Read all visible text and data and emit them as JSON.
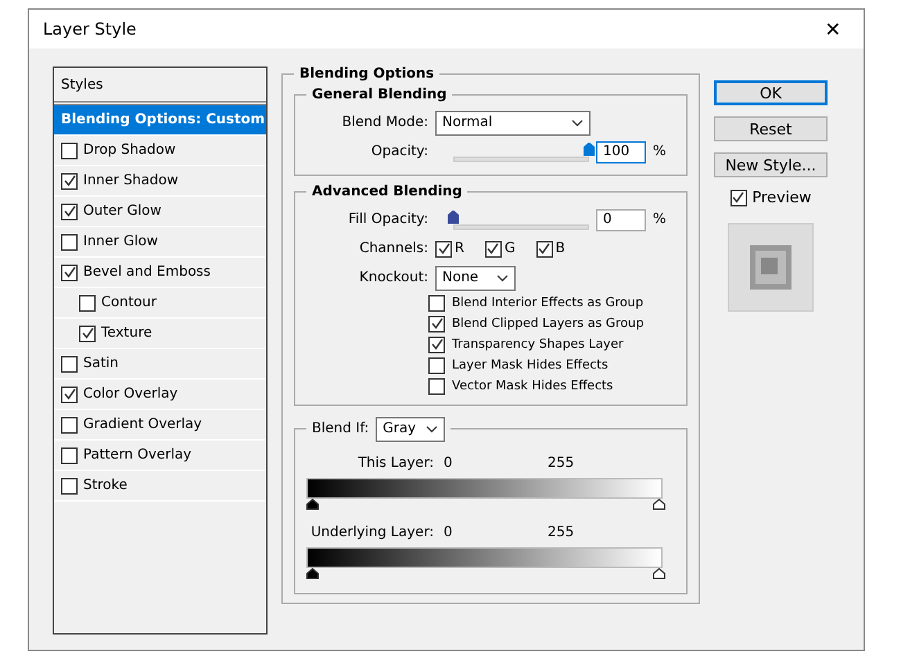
{
  "window": {
    "title": "Layer Style",
    "close": "✕"
  },
  "styles_header": "Styles",
  "styles": [
    {
      "label": "Blending Options: Custom",
      "kind": "header",
      "selected": true
    },
    {
      "label": "Drop Shadow",
      "kind": "check",
      "checked": false,
      "selected": false
    },
    {
      "label": "Inner Shadow",
      "kind": "check",
      "checked": true,
      "selected": false
    },
    {
      "label": "Outer Glow",
      "kind": "check",
      "checked": true,
      "selected": false
    },
    {
      "label": "Inner Glow",
      "kind": "check",
      "checked": false,
      "selected": false
    },
    {
      "label": "Bevel and Emboss",
      "kind": "check",
      "checked": true,
      "selected": false,
      "children": [
        {
          "label": "Contour",
          "kind": "check",
          "checked": false,
          "selected": false
        },
        {
          "label": "Texture",
          "kind": "check",
          "checked": true,
          "selected": false
        }
      ]
    },
    {
      "label": "Satin",
      "kind": "check",
      "checked": false,
      "selected": false
    },
    {
      "label": "Color Overlay",
      "kind": "check",
      "checked": true,
      "selected": false
    },
    {
      "label": "Gradient Overlay",
      "kind": "check",
      "checked": false,
      "selected": false
    },
    {
      "label": "Pattern Overlay",
      "kind": "check",
      "checked": false,
      "selected": false
    },
    {
      "label": "Stroke",
      "kind": "check",
      "checked": false,
      "selected": false
    }
  ],
  "blending_options": {
    "title": "Blending Options",
    "general": {
      "title": "General Blending",
      "blend_mode_label": "Blend Mode:",
      "blend_mode": "Normal",
      "opacity_label": "Opacity:",
      "opacity": {
        "level": 1,
        "value": "100",
        "unit": "%"
      }
    },
    "advanced": {
      "title": "Advanced Blending",
      "fill_opacity_label": "Fill Opacity:",
      "fill_opacity": {
        "level": 0,
        "value": "0",
        "unit": "%"
      },
      "channels_label": "Channels:",
      "channels": [
        {
          "label": "R",
          "checked": true
        },
        {
          "label": "G",
          "checked": true
        },
        {
          "label": "B",
          "checked": true
        }
      ],
      "knockout_label": "Knockout:",
      "knockout": "None",
      "options": [
        {
          "label": "Blend Interior Effects as Group",
          "checked": false
        },
        {
          "label": "Blend Clipped Layers as Group",
          "checked": true
        },
        {
          "label": "Transparency Shapes Layer",
          "checked": true
        },
        {
          "label": "Layer Mask Hides Effects",
          "checked": false
        },
        {
          "label": "Vector Mask Hides Effects",
          "checked": false
        }
      ]
    },
    "blend_if": {
      "label": "Blend If:",
      "value": "Gray",
      "ramps": [
        {
          "label": "This Layer:",
          "low": "0",
          "high": "255"
        },
        {
          "label": "Underlying Layer:",
          "low": "0",
          "high": "255"
        }
      ]
    }
  },
  "buttons": [
    {
      "label": "OK",
      "default": true
    },
    {
      "label": "Reset",
      "default": false
    },
    {
      "label": "New Style...",
      "default": false
    }
  ],
  "preview": {
    "label": "Preview",
    "checked": true
  }
}
